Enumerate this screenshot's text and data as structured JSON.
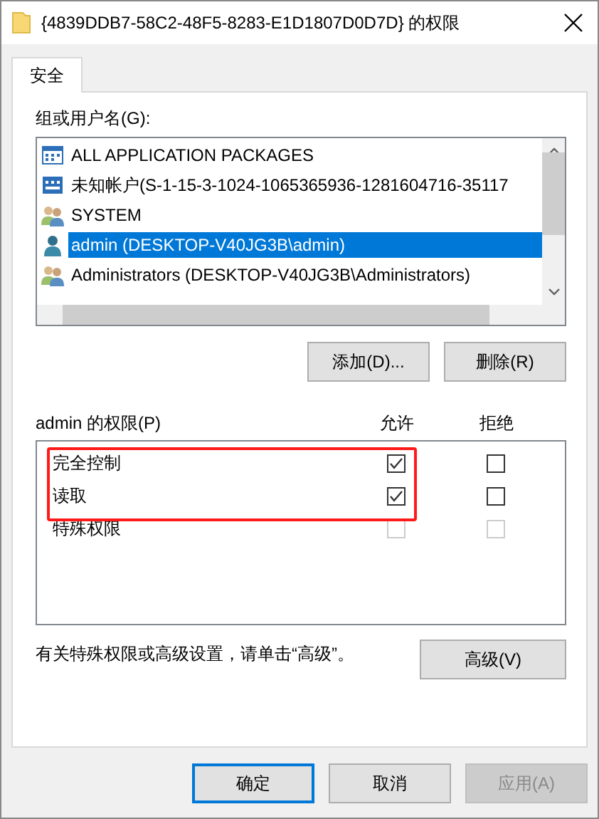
{
  "window": {
    "title": "{4839DDB7-58C2-48F5-8283-E1D1807D0D7D} 的权限"
  },
  "tabs": [
    {
      "label": "安全",
      "selected": true
    }
  ],
  "group_label": "组或用户名(G):",
  "principals": [
    {
      "kind": "package",
      "name": "ALL APPLICATION PACKAGES",
      "selected": false
    },
    {
      "kind": "account",
      "name": "未知帐户(S-1-15-3-1024-1065365936-1281604716-35117",
      "selected": false
    },
    {
      "kind": "group",
      "name": "SYSTEM",
      "selected": false
    },
    {
      "kind": "user",
      "name": "admin (DESKTOP-V40JG3B\\admin)",
      "selected": true
    },
    {
      "kind": "group",
      "name": "Administrators (DESKTOP-V40JG3B\\Administrators)",
      "selected": false
    }
  ],
  "principal_buttons": [
    "添加(D)...",
    "删除(R)"
  ],
  "permissions_label": "admin 的权限(P)",
  "columns": [
    "允许",
    "拒绝"
  ],
  "permissions": [
    {
      "name": "完全控制",
      "highlighted": true,
      "allow": {
        "checked": true,
        "disabled": false
      },
      "deny": {
        "checked": false,
        "disabled": false
      }
    },
    {
      "name": "读取",
      "highlighted": true,
      "allow": {
        "checked": true,
        "disabled": false
      },
      "deny": {
        "checked": false,
        "disabled": false
      }
    },
    {
      "name": "特殊权限",
      "highlighted": false,
      "allow": {
        "checked": false,
        "disabled": true
      },
      "deny": {
        "checked": false,
        "disabled": true
      }
    }
  ],
  "advanced_hint": "有关特殊权限或高级设置，请单击“高级”。",
  "advanced_button": "高级(V)",
  "buttons": [
    {
      "label": "确定",
      "kind": "default",
      "disabled": false
    },
    {
      "label": "取消",
      "kind": "normal",
      "disabled": false
    },
    {
      "label": "应用(A)",
      "kind": "normal",
      "disabled": true
    }
  ]
}
